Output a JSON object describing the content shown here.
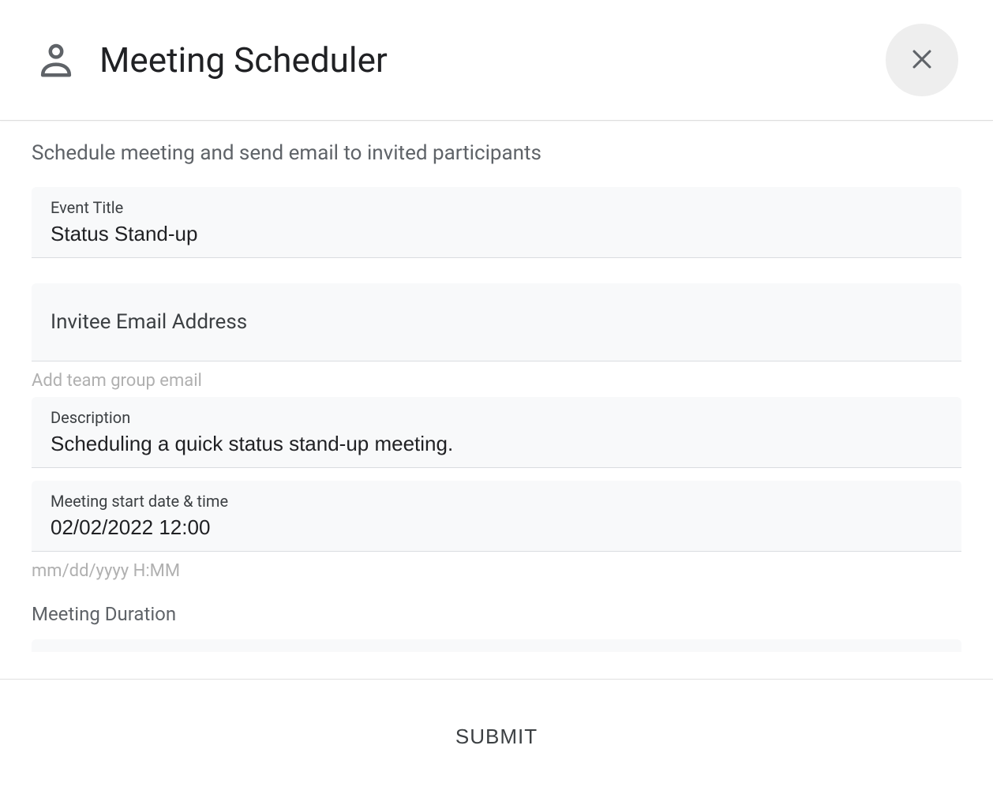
{
  "header": {
    "title": "Meeting Scheduler"
  },
  "subtitle": "Schedule meeting and send email to invited participants",
  "fields": {
    "event_title": {
      "label": "Event Title",
      "value": "Status Stand-up"
    },
    "invitee_email": {
      "placeholder": "Invitee Email Address",
      "helper": "Add team group email"
    },
    "description": {
      "label": "Description",
      "value": "Scheduling a quick status stand-up meeting."
    },
    "start_datetime": {
      "label": "Meeting start date & time",
      "value": "02/02/2022 12:00",
      "helper": "mm/dd/yyyy H:MM"
    },
    "duration": {
      "label": "Meeting Duration"
    }
  },
  "footer": {
    "submit_label": "SUBMIT"
  }
}
